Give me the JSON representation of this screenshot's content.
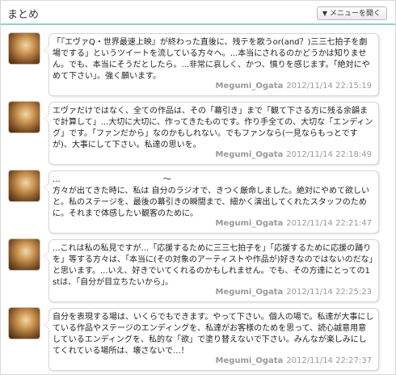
{
  "header": {
    "title": "まとめ",
    "menu_button": "メニューを開く"
  },
  "posts": [
    {
      "text": "「『エヴァQ・世界最速上映』が終わった直後に、残テを歌うor(and？)三三七拍子を劇場でする」というツイートを流している方々へ。...本当にされるのかどうかは知りません。でも、本当にそうだとしたら。...非常に哀しく、かつ、憤りを感じます。「絶対にやめて下さい」。強く願います。",
      "user": "Megumi_Ogata",
      "time": "2012/11/14 22:15:19"
    },
    {
      "text": "エヴァだけではなく、全ての作品は、その「幕引き」まで「観て下さる方に残る余韻まで計算して」...大切に大切に、作ってきたものです。作り手全ての、大切な「エンディング」です。「ファンだから」なのかもしれない。でもファンなら(一見ならもっとですが)、大事にして下さい。私達の思いを。",
      "user": "Megumi_Ogata",
      "time": "2012/11/14 22:18:49"
    },
    {
      "text": "...                                        〜\n方々が出てきた時に、私は 自分のラジオで、きつく厳命しました。絶対にやめて欲しいと。私のステージを、最後の幕引きの瞬間まで、細かく演出してくれたスタッフのために。それまで体感したい観客のために。",
      "user": "Megumi_Ogata",
      "time": "2012/11/14 22:21:47"
    },
    {
      "text": "...これは私の私見ですが...「応援するために三三七拍子を」「応援するために応援の踊りを」等する方々は、「本当に(その対象のアーティストや作品が)好きなのではないのだな」と思います。...いえ、好きでいてくれるのかもしれません。でも、その方達にとっての1stは、「自分が目立ちたいから」。",
      "user": "Megumi_Ogata",
      "time": "2012/11/14 22:25:23"
    },
    {
      "text": "自分を表現する場は、いくらでもできます。やって下さい。個人の場で。私達が大事にしている作品やステージのエンディングを、私達がお客様のためを思って、読心誠意用意しているエンディングを、私的な「欲」で塗り替えないで下さい。みんなが楽しみにしてくれている場所は、壊さないで...！",
      "user": "Megumi_Ogata",
      "time": "2012/11/14 22:27:37"
    }
  ]
}
